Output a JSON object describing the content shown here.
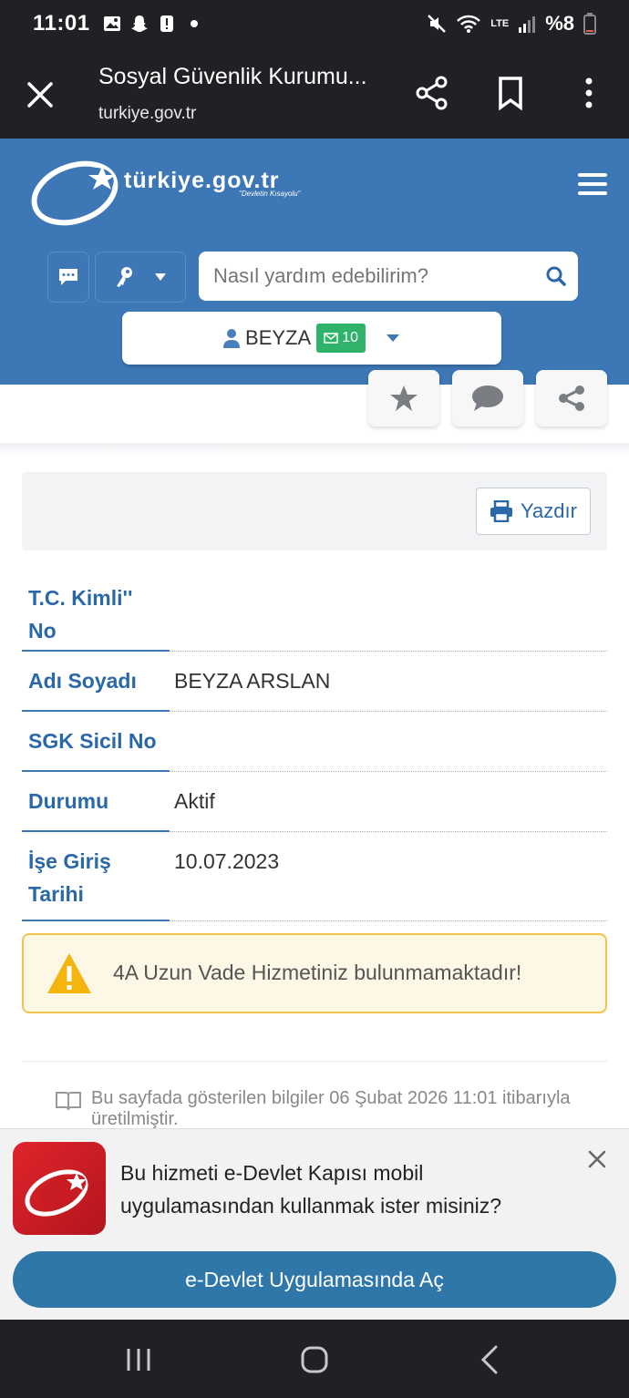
{
  "status_bar": {
    "time": "11:01",
    "battery": "%8",
    "network": "LTE"
  },
  "browser": {
    "title": "Sosyal Güvenlik Kurumu...",
    "url": "turkiye.gov.tr"
  },
  "site": {
    "logo_text": "türkiye.gov.tr",
    "logo_tagline": "\"Devletin Kısayolu\"",
    "search_placeholder": "Nasıl yardım edebilirim?",
    "user_name": "BEYZA",
    "message_count": "10"
  },
  "page": {
    "print_label": "Yazdır",
    "rows": [
      {
        "label": "T.C. Kimli'' No",
        "value": ""
      },
      {
        "label": "Adı Soyadı",
        "value": "BEYZA ARSLAN"
      },
      {
        "label": "SGK Sicil No",
        "value": ""
      },
      {
        "label": "Durumu",
        "value": "Aktif"
      },
      {
        "label": "İşe Giriş Tarihi",
        "value": "10.07.2023"
      }
    ],
    "warning": "4A Uzun Vade Hizmetiniz bulunmamaktadır!",
    "footnote": "Bu sayfada gösterilen bilgiler 06 Şubat 2026 11:01 itibarıyla üretilmiştir."
  },
  "app_banner": {
    "text": "Bu hizmeti e-Devlet Kapısı mobil uygulamasından kullanmak ister misiniz?",
    "button": "e-Devlet Uygulamasında Aç"
  },
  "colors": {
    "header_blue": "#3d77b5",
    "link_blue": "#2a68a8",
    "badge_green": "#2fb36b",
    "warning_border": "#f0c44a",
    "button_blue": "#2f77a8"
  }
}
